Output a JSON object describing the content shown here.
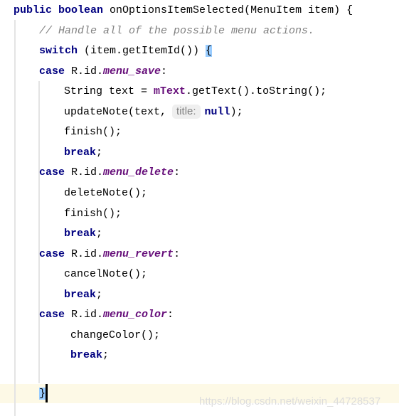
{
  "editor": {
    "lines": [
      {
        "indent": 0,
        "tokens": [
          {
            "t": "kw",
            "v": "public boolean"
          },
          {
            "t": "",
            "v": " onOptionsItemSelected(MenuItem item) {"
          }
        ]
      },
      {
        "indent": 1,
        "tokens": [
          {
            "t": "cm",
            "v": "// Handle all of the possible menu actions."
          }
        ]
      },
      {
        "indent": 1,
        "tokens": [
          {
            "t": "kw",
            "v": "switch"
          },
          {
            "t": "",
            "v": " (item.getItemId()) "
          },
          {
            "t": "brace-hl",
            "v": "{"
          }
        ]
      },
      {
        "indent": 1,
        "tokens": [
          {
            "t": "kw",
            "v": "case"
          },
          {
            "t": "",
            "v": " R.id."
          },
          {
            "t": "const",
            "v": "menu_save"
          },
          {
            "t": "",
            "v": ":"
          }
        ]
      },
      {
        "indent": 2,
        "tokens": [
          {
            "t": "",
            "v": "String text = "
          },
          {
            "t": "fld",
            "v": "mText"
          },
          {
            "t": "",
            "v": ".getText().toString();"
          }
        ]
      },
      {
        "indent": 2,
        "tokens": [
          {
            "t": "",
            "v": "updateNote(text,"
          },
          {
            "t": "hint",
            "v": "title:"
          },
          {
            "t": "kw",
            "v": "null"
          },
          {
            "t": "",
            "v": ");"
          }
        ]
      },
      {
        "indent": 2,
        "tokens": [
          {
            "t": "",
            "v": "finish();"
          }
        ]
      },
      {
        "indent": 2,
        "tokens": [
          {
            "t": "kw",
            "v": "break"
          },
          {
            "t": "",
            "v": ";"
          }
        ]
      },
      {
        "indent": 1,
        "tokens": [
          {
            "t": "kw",
            "v": "case"
          },
          {
            "t": "",
            "v": " R.id."
          },
          {
            "t": "const",
            "v": "menu_delete"
          },
          {
            "t": "",
            "v": ":"
          }
        ]
      },
      {
        "indent": 2,
        "tokens": [
          {
            "t": "",
            "v": "deleteNote();"
          }
        ]
      },
      {
        "indent": 2,
        "tokens": [
          {
            "t": "",
            "v": "finish();"
          }
        ]
      },
      {
        "indent": 2,
        "tokens": [
          {
            "t": "kw",
            "v": "break"
          },
          {
            "t": "",
            "v": ";"
          }
        ]
      },
      {
        "indent": 1,
        "tokens": [
          {
            "t": "kw",
            "v": "case"
          },
          {
            "t": "",
            "v": " R.id."
          },
          {
            "t": "const",
            "v": "menu_revert"
          },
          {
            "t": "",
            "v": ":"
          }
        ]
      },
      {
        "indent": 2,
        "tokens": [
          {
            "t": "",
            "v": "cancelNote();"
          }
        ]
      },
      {
        "indent": 2,
        "tokens": [
          {
            "t": "kw",
            "v": "break"
          },
          {
            "t": "",
            "v": ";"
          }
        ]
      },
      {
        "indent": 1,
        "tokens": [
          {
            "t": "kw",
            "v": "case"
          },
          {
            "t": "",
            "v": " R.id."
          },
          {
            "t": "const",
            "v": "menu_color"
          },
          {
            "t": "",
            "v": ":"
          }
        ]
      },
      {
        "indent": 3,
        "tokens": [
          {
            "t": "",
            "v": "changeColor();"
          }
        ]
      },
      {
        "indent": 3,
        "tokens": [
          {
            "t": "kw",
            "v": "break"
          },
          {
            "t": "",
            "v": ";"
          }
        ]
      },
      {
        "indent": 1,
        "tokens": []
      },
      {
        "indent": 1,
        "tokens": [
          {
            "t": "brace-hl",
            "v": "}"
          },
          {
            "t": "caret",
            "v": ""
          }
        ]
      }
    ],
    "watermark": "https://blog.csdn.net/weixin_44728537"
  }
}
